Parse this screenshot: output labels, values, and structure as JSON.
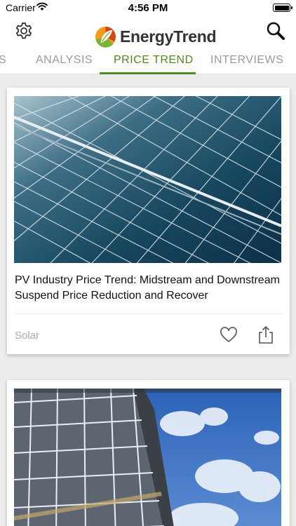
{
  "status_bar": {
    "carrier": "Carrier",
    "time": "4:56 PM"
  },
  "header": {
    "brand": "EnergyTrend",
    "tabs": [
      {
        "label": "S"
      },
      {
        "label": "ANALYSIS"
      },
      {
        "label": "PRICE TREND",
        "active": true
      },
      {
        "label": "INTERVIEWS"
      }
    ]
  },
  "articles": [
    {
      "title": "PV Industry Price Trend: Midstream and Downstream Suspend Price Reduction and Recover",
      "category": "Solar",
      "image": "solar-panel-closeup"
    },
    {
      "image": "solar-panels-sky"
    }
  ],
  "colors": {
    "accent": "#4f8a1e",
    "tab_inactive": "#9a9a9a",
    "background": "#ececec"
  }
}
